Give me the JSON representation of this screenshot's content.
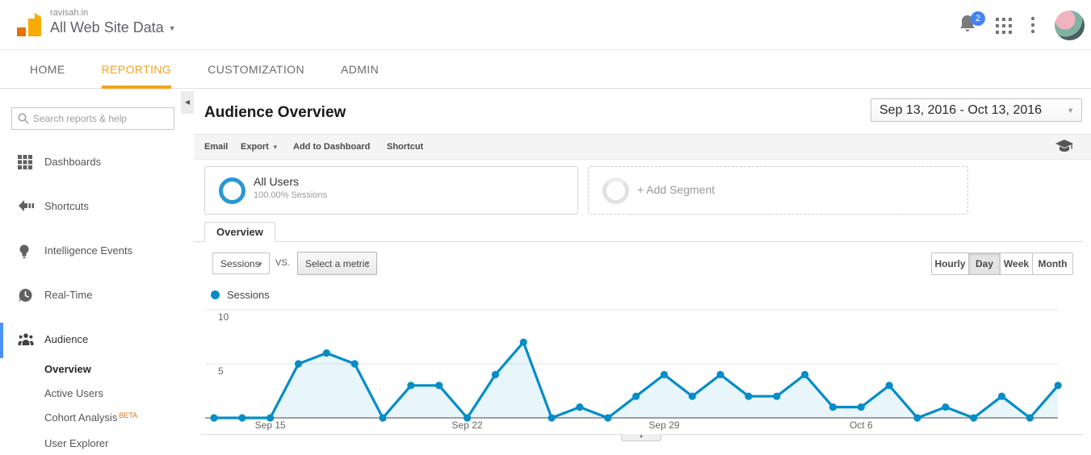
{
  "header": {
    "property_domain": "ravisah.in",
    "property_view": "All Web Site Data",
    "notification_count": "2"
  },
  "nav": {
    "items": [
      {
        "label": "HOME",
        "active": false
      },
      {
        "label": "REPORTING",
        "active": true
      },
      {
        "label": "CUSTOMIZATION",
        "active": false
      },
      {
        "label": "ADMIN",
        "active": false
      }
    ]
  },
  "sidebar": {
    "search_placeholder": "Search reports & help",
    "items": [
      {
        "label": "Dashboards"
      },
      {
        "label": "Shortcuts"
      },
      {
        "label": "Intelligence Events"
      },
      {
        "label": "Real-Time"
      },
      {
        "label": "Audience",
        "active": true
      }
    ],
    "audience_children": [
      {
        "label": "Overview",
        "current": true
      },
      {
        "label": "Active Users"
      },
      {
        "label": "Cohort Analysis",
        "badge": "BETA"
      },
      {
        "label": "User Explorer"
      }
    ]
  },
  "main": {
    "title": "Audience Overview",
    "date_range": "Sep 13, 2016 - Oct 13, 2016",
    "toolbar": {
      "email": "Email",
      "export": "Export",
      "add_to_dashboard": "Add to Dashboard",
      "shortcut": "Shortcut"
    },
    "segments": {
      "all_users_title": "All Users",
      "all_users_subtitle": "100.00% Sessions",
      "add_segment_label": "+ Add Segment"
    },
    "tab_label": "Overview",
    "controls": {
      "metric_primary": "Sessions",
      "vs_label": "vs.",
      "metric_secondary": "Select a metric",
      "intervals": [
        {
          "label": "Hourly",
          "active": false
        },
        {
          "label": "Day",
          "active": true
        },
        {
          "label": "Week",
          "active": false
        },
        {
          "label": "Month",
          "active": false
        }
      ]
    },
    "legend_label": "Sessions"
  },
  "colors": {
    "accent_orange": "#f5a21d",
    "chart_line_blue": "#058dc7",
    "badge_blue": "#4285f4",
    "beta_orange": "#e8710a",
    "segment_donut_blue": "#2a97d4"
  },
  "chart_data": {
    "type": "line",
    "series": [
      {
        "name": "Sessions",
        "values": [
          0,
          0,
          0,
          5,
          6,
          5,
          0,
          3,
          3,
          0,
          4,
          7,
          0,
          1,
          0,
          2,
          4,
          2,
          4,
          2,
          2,
          4,
          1,
          1,
          3,
          0,
          1,
          0,
          2,
          0,
          3
        ]
      }
    ],
    "categories": [
      "Sep 13",
      "Sep 14",
      "Sep 15",
      "Sep 16",
      "Sep 17",
      "Sep 18",
      "Sep 19",
      "Sep 20",
      "Sep 21",
      "Sep 22",
      "Sep 23",
      "Sep 24",
      "Sep 25",
      "Sep 26",
      "Sep 27",
      "Sep 28",
      "Sep 29",
      "Sep 30",
      "Oct 1",
      "Oct 2",
      "Oct 3",
      "Oct 4",
      "Oct 5",
      "Oct 6",
      "Oct 7",
      "Oct 8",
      "Oct 9",
      "Oct 10",
      "Oct 11",
      "Oct 12",
      "Oct 13"
    ],
    "xticks": [
      {
        "index": 2,
        "label": "Sep 15"
      },
      {
        "index": 9,
        "label": "Sep 22"
      },
      {
        "index": 16,
        "label": "Sep 29"
      },
      {
        "index": 23,
        "label": "Oct 6"
      }
    ],
    "yticks": [
      5,
      10
    ],
    "ylim": [
      0,
      10
    ],
    "grid": true,
    "line_color": "#058dc7",
    "area_opacity": 0.09,
    "legend_position": "top-left",
    "title": "",
    "xlabel": "",
    "ylabel": ""
  }
}
